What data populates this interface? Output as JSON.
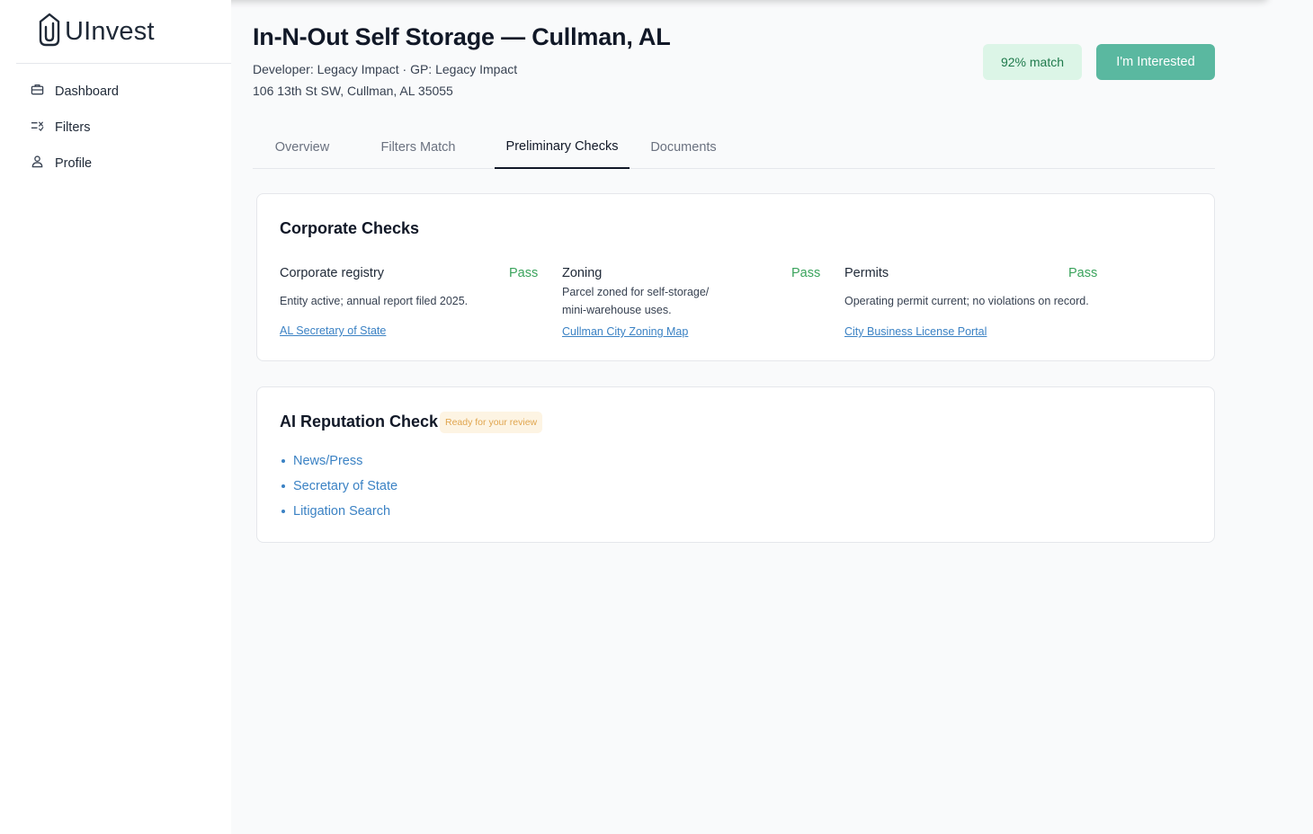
{
  "app": {
    "name": "UInvest"
  },
  "sidebar": {
    "items": [
      {
        "label": "Dashboard",
        "icon": "briefcase-icon"
      },
      {
        "label": "Filters",
        "icon": "filter-check-icon"
      },
      {
        "label": "Profile",
        "icon": "user-icon"
      }
    ]
  },
  "header": {
    "title": "In-N-Out Self Storage — Cullman, AL",
    "subtitle": "Developer: Legacy Impact · GP: Legacy Impact",
    "address": "106 13th St SW, Cullman, AL 35055",
    "match": "92% match",
    "interest_button": "I'm Interested"
  },
  "tabs": [
    {
      "label": "Overview",
      "active": false
    },
    {
      "label": "Filters Match",
      "active": false
    },
    {
      "label": "Preliminary Checks",
      "active": true
    },
    {
      "label": "Documents",
      "active": false
    }
  ],
  "corporate": {
    "title": "Corporate Checks",
    "checks": [
      {
        "name": "Corporate registry",
        "status": "Pass",
        "description": "Entity active; annual report filed 2025.",
        "link": "AL Secretary of State"
      },
      {
        "name": "Zoning",
        "status": "Pass",
        "description": "Parcel zoned for self-storage/ mini-warehouse uses.",
        "link": "Cullman City Zoning Map"
      },
      {
        "name": "Permits",
        "status": "Pass",
        "description": "Operating permit current; no violations on record.",
        "link": "City Business License Portal"
      }
    ]
  },
  "ai_check": {
    "title": "AI Reputation Check",
    "badge": "Ready for your review",
    "items": [
      "News/Press",
      "Secretary of State",
      "Litigation Search"
    ]
  },
  "colors": {
    "accent": "#5ab8a0",
    "match_bg": "#dcf5e7",
    "match_text": "#1f7a4c",
    "pass": "#3aa35c",
    "link": "#3b82c4",
    "badge_bg": "#fdf4e3",
    "badge_text": "#e0a54e"
  }
}
